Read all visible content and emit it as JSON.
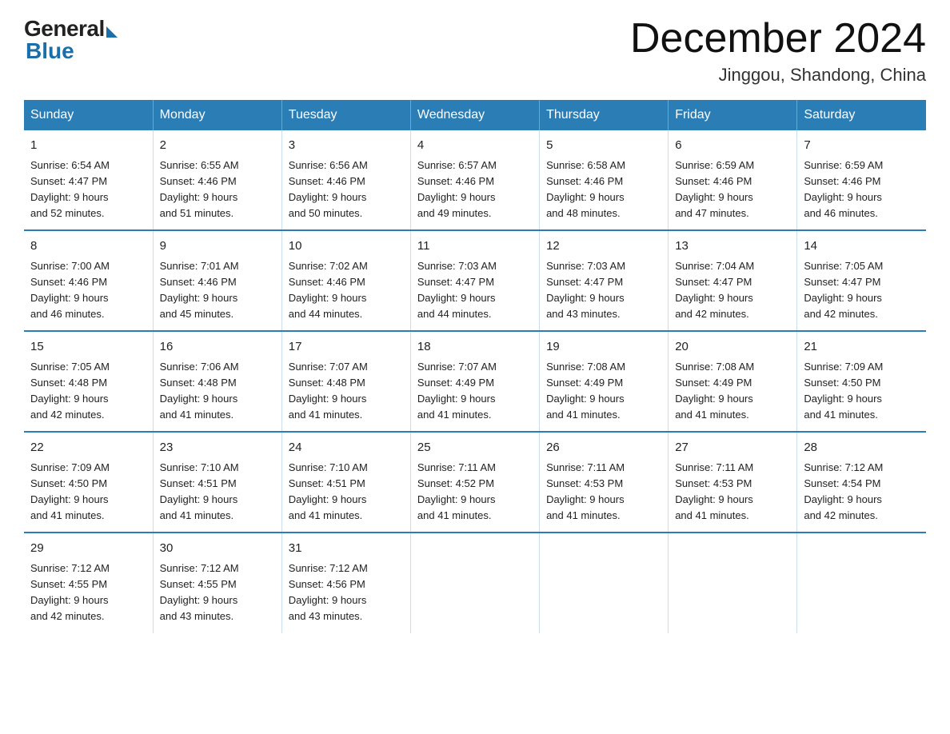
{
  "header": {
    "logo_general": "General",
    "logo_blue": "Blue",
    "month_title": "December 2024",
    "location": "Jinggou, Shandong, China"
  },
  "days_of_week": [
    "Sunday",
    "Monday",
    "Tuesday",
    "Wednesday",
    "Thursday",
    "Friday",
    "Saturday"
  ],
  "weeks": [
    [
      {
        "day": "1",
        "sunrise": "6:54 AM",
        "sunset": "4:47 PM",
        "daylight": "9 hours and 52 minutes."
      },
      {
        "day": "2",
        "sunrise": "6:55 AM",
        "sunset": "4:46 PM",
        "daylight": "9 hours and 51 minutes."
      },
      {
        "day": "3",
        "sunrise": "6:56 AM",
        "sunset": "4:46 PM",
        "daylight": "9 hours and 50 minutes."
      },
      {
        "day": "4",
        "sunrise": "6:57 AM",
        "sunset": "4:46 PM",
        "daylight": "9 hours and 49 minutes."
      },
      {
        "day": "5",
        "sunrise": "6:58 AM",
        "sunset": "4:46 PM",
        "daylight": "9 hours and 48 minutes."
      },
      {
        "day": "6",
        "sunrise": "6:59 AM",
        "sunset": "4:46 PM",
        "daylight": "9 hours and 47 minutes."
      },
      {
        "day": "7",
        "sunrise": "6:59 AM",
        "sunset": "4:46 PM",
        "daylight": "9 hours and 46 minutes."
      }
    ],
    [
      {
        "day": "8",
        "sunrise": "7:00 AM",
        "sunset": "4:46 PM",
        "daylight": "9 hours and 46 minutes."
      },
      {
        "day": "9",
        "sunrise": "7:01 AM",
        "sunset": "4:46 PM",
        "daylight": "9 hours and 45 minutes."
      },
      {
        "day": "10",
        "sunrise": "7:02 AM",
        "sunset": "4:46 PM",
        "daylight": "9 hours and 44 minutes."
      },
      {
        "day": "11",
        "sunrise": "7:03 AM",
        "sunset": "4:47 PM",
        "daylight": "9 hours and 44 minutes."
      },
      {
        "day": "12",
        "sunrise": "7:03 AM",
        "sunset": "4:47 PM",
        "daylight": "9 hours and 43 minutes."
      },
      {
        "day": "13",
        "sunrise": "7:04 AM",
        "sunset": "4:47 PM",
        "daylight": "9 hours and 42 minutes."
      },
      {
        "day": "14",
        "sunrise": "7:05 AM",
        "sunset": "4:47 PM",
        "daylight": "9 hours and 42 minutes."
      }
    ],
    [
      {
        "day": "15",
        "sunrise": "7:05 AM",
        "sunset": "4:48 PM",
        "daylight": "9 hours and 42 minutes."
      },
      {
        "day": "16",
        "sunrise": "7:06 AM",
        "sunset": "4:48 PM",
        "daylight": "9 hours and 41 minutes."
      },
      {
        "day": "17",
        "sunrise": "7:07 AM",
        "sunset": "4:48 PM",
        "daylight": "9 hours and 41 minutes."
      },
      {
        "day": "18",
        "sunrise": "7:07 AM",
        "sunset": "4:49 PM",
        "daylight": "9 hours and 41 minutes."
      },
      {
        "day": "19",
        "sunrise": "7:08 AM",
        "sunset": "4:49 PM",
        "daylight": "9 hours and 41 minutes."
      },
      {
        "day": "20",
        "sunrise": "7:08 AM",
        "sunset": "4:49 PM",
        "daylight": "9 hours and 41 minutes."
      },
      {
        "day": "21",
        "sunrise": "7:09 AM",
        "sunset": "4:50 PM",
        "daylight": "9 hours and 41 minutes."
      }
    ],
    [
      {
        "day": "22",
        "sunrise": "7:09 AM",
        "sunset": "4:50 PM",
        "daylight": "9 hours and 41 minutes."
      },
      {
        "day": "23",
        "sunrise": "7:10 AM",
        "sunset": "4:51 PM",
        "daylight": "9 hours and 41 minutes."
      },
      {
        "day": "24",
        "sunrise": "7:10 AM",
        "sunset": "4:51 PM",
        "daylight": "9 hours and 41 minutes."
      },
      {
        "day": "25",
        "sunrise": "7:11 AM",
        "sunset": "4:52 PM",
        "daylight": "9 hours and 41 minutes."
      },
      {
        "day": "26",
        "sunrise": "7:11 AM",
        "sunset": "4:53 PM",
        "daylight": "9 hours and 41 minutes."
      },
      {
        "day": "27",
        "sunrise": "7:11 AM",
        "sunset": "4:53 PM",
        "daylight": "9 hours and 41 minutes."
      },
      {
        "day": "28",
        "sunrise": "7:12 AM",
        "sunset": "4:54 PM",
        "daylight": "9 hours and 42 minutes."
      }
    ],
    [
      {
        "day": "29",
        "sunrise": "7:12 AM",
        "sunset": "4:55 PM",
        "daylight": "9 hours and 42 minutes."
      },
      {
        "day": "30",
        "sunrise": "7:12 AM",
        "sunset": "4:55 PM",
        "daylight": "9 hours and 43 minutes."
      },
      {
        "day": "31",
        "sunrise": "7:12 AM",
        "sunset": "4:56 PM",
        "daylight": "9 hours and 43 minutes."
      },
      null,
      null,
      null,
      null
    ]
  ],
  "labels": {
    "sunrise": "Sunrise:",
    "sunset": "Sunset:",
    "daylight": "Daylight:"
  }
}
